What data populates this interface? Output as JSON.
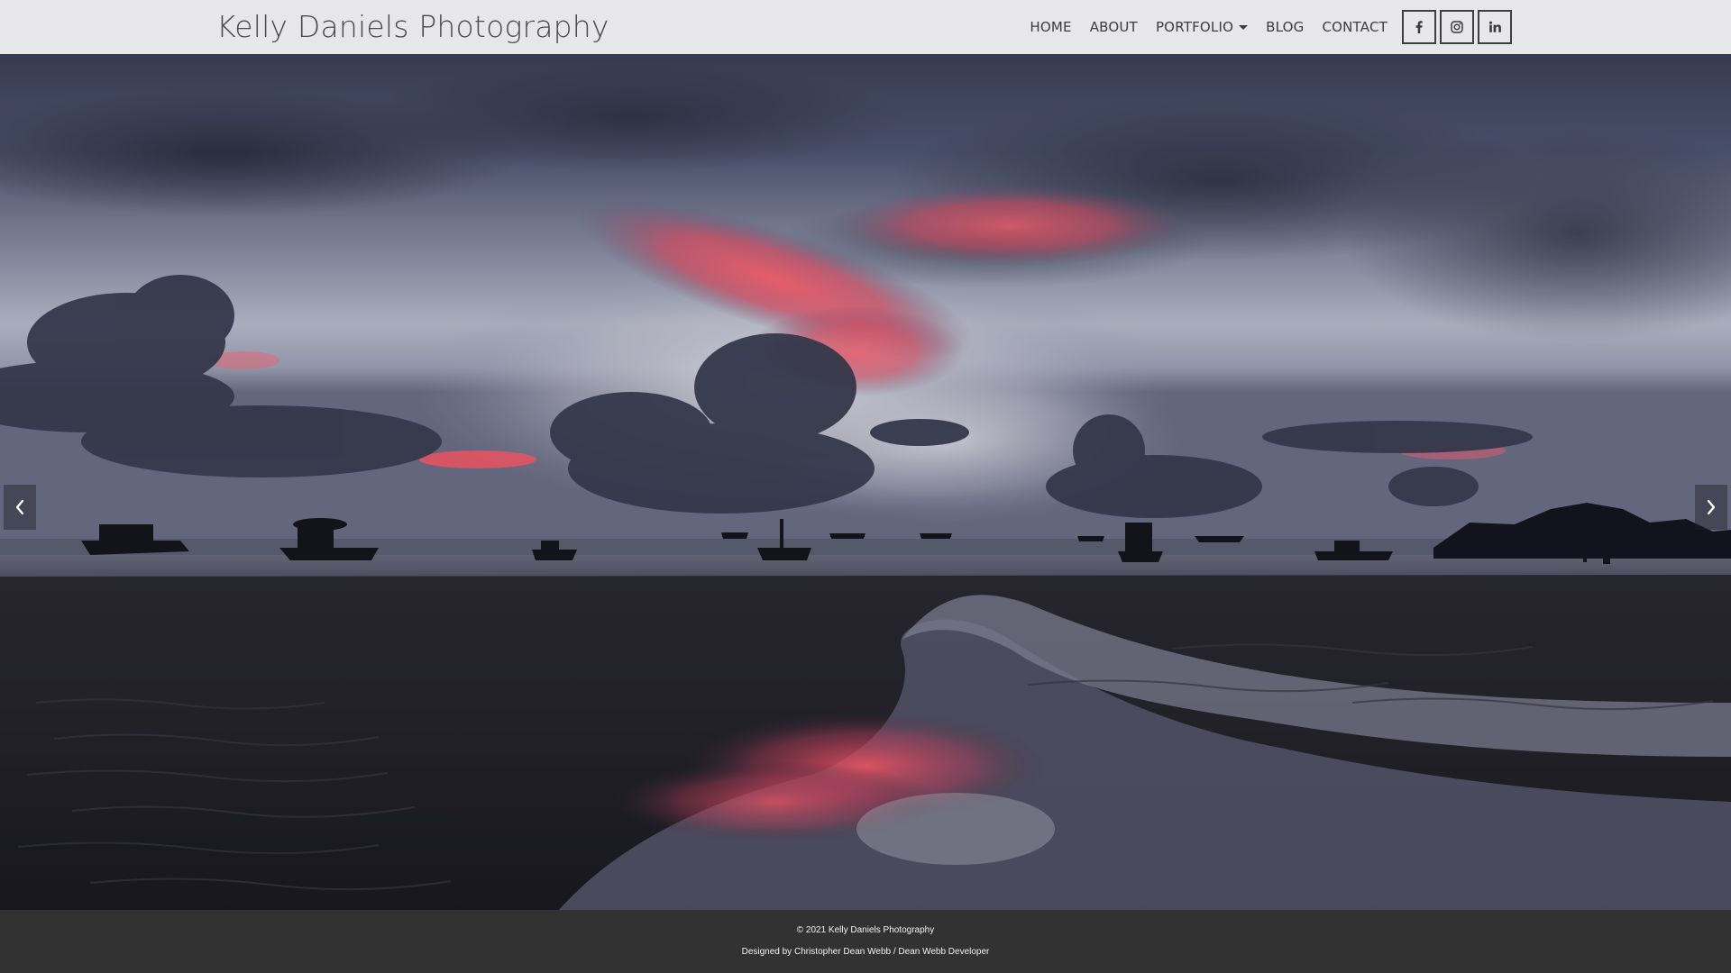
{
  "brand": {
    "title": "Kelly Daniels Photography"
  },
  "nav": {
    "items": [
      {
        "label": "HOME"
      },
      {
        "label": "ABOUT"
      },
      {
        "label": "PORTFOLIO"
      },
      {
        "label": "BLOG"
      },
      {
        "label": "CONTACT"
      }
    ]
  },
  "social": {
    "facebook": {
      "icon": "facebook-icon",
      "label": "f"
    },
    "instagram": {
      "icon": "instagram-icon"
    },
    "linkedin": {
      "icon": "linkedin-icon",
      "label": "in"
    }
  },
  "carousel": {
    "prev_icon": "chevron-left-icon",
    "next_icon": "chevron-right-icon"
  },
  "footer": {
    "copyright": "© 2021 Kelly Daniels Photography",
    "designed_by_prefix": "Designed by ",
    "designer_link": "Christopher Dean Webb / Dean Webb Developer"
  },
  "colors": {
    "header_bg": "#e7e7ea",
    "footer_bg": "#323232",
    "sunset_accent": "#ff5a6a"
  }
}
